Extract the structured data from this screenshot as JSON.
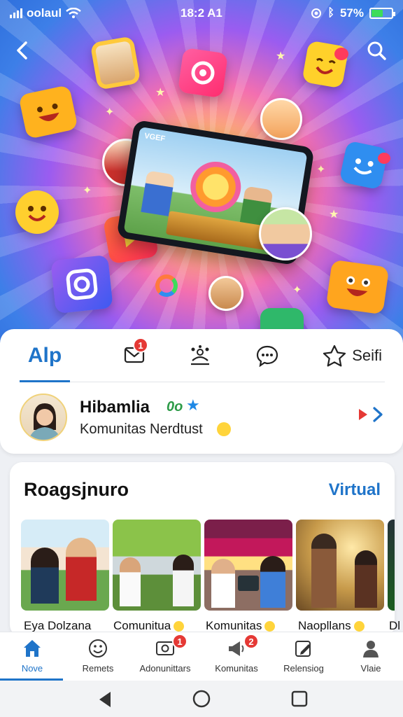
{
  "status_bar": {
    "carrier": "oolaul",
    "time": "18:2 A1",
    "battery": "57%",
    "battery_level": 0.57
  },
  "hero": {
    "tablet_screen_text": "VGEF"
  },
  "tabs": {
    "active_label": "Alp",
    "messages_badge": "1",
    "selfi_label": "Seifi"
  },
  "profile": {
    "name": "Hibamlia",
    "tag": "0o",
    "subtitle": "Komunitas Nerdtust"
  },
  "community": {
    "title": "Roagsjnuro",
    "link_label": "Virtual",
    "cards": [
      {
        "label": "Eya Dolzana",
        "emoji": false
      },
      {
        "label": "Comunitua",
        "emoji": true
      },
      {
        "label": "Komunitas",
        "emoji": true
      },
      {
        "label": "Naopllans",
        "emoji": true
      },
      {
        "label": "Dl",
        "emoji": false
      }
    ]
  },
  "bottom_nav": {
    "items": [
      {
        "label": "Nove",
        "icon": "home-icon",
        "active": true,
        "badge": ""
      },
      {
        "label": "Remets",
        "icon": "smiley-icon",
        "active": false,
        "badge": ""
      },
      {
        "label": "Adonunittars",
        "icon": "photo-icon",
        "active": false,
        "badge": "1"
      },
      {
        "label": "Komunitas",
        "icon": "megaphone-icon",
        "active": false,
        "badge": "2"
      },
      {
        "label": "Relensiog",
        "icon": "edit-icon",
        "active": false,
        "badge": ""
      },
      {
        "label": "Vlaie",
        "icon": "person-icon",
        "active": false,
        "badge": ""
      }
    ]
  },
  "colors": {
    "accent": "#1f74c9",
    "badge": "#e53935",
    "battery": "#3ddc5a"
  }
}
